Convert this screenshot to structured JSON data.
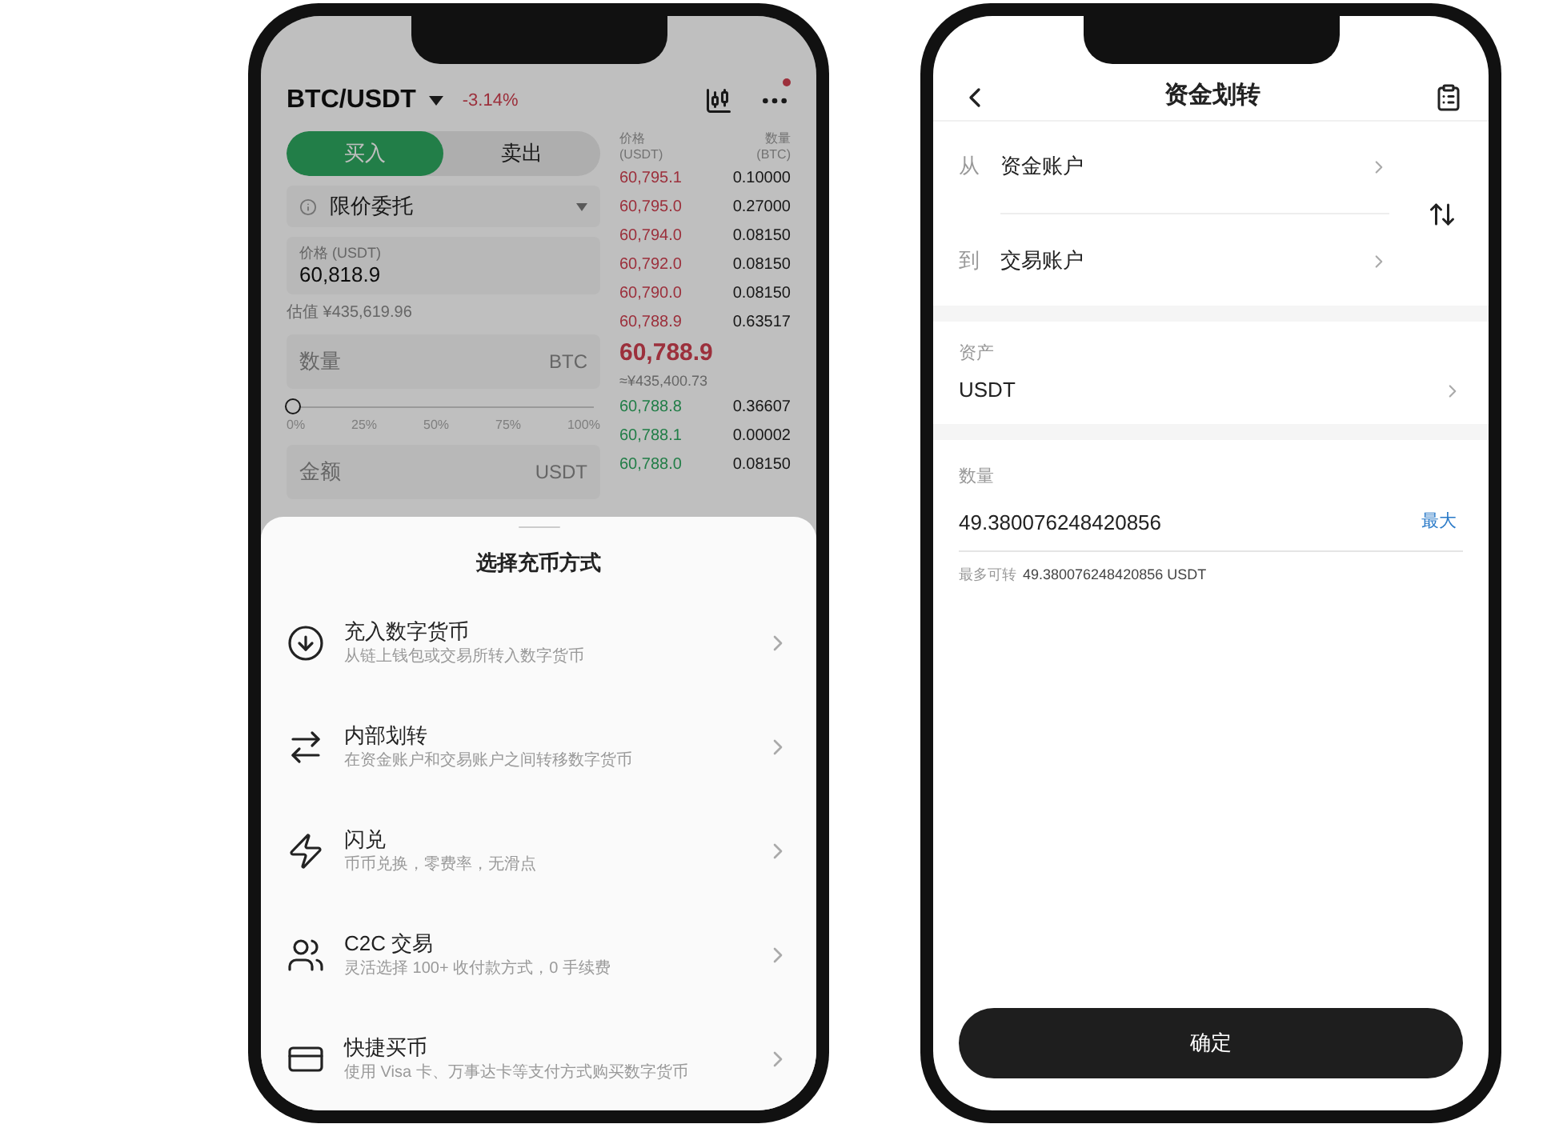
{
  "trade_screen": {
    "pair": "BTC/USDT",
    "change": "-3.14%",
    "side_tabs": [
      {
        "label": "买入",
        "selected": true
      },
      {
        "label": "卖出",
        "selected": false
      }
    ],
    "order_type": "限价委托",
    "price_field": {
      "label": "价格 (USDT)",
      "value": "60,818.9"
    },
    "estimate": "估值 ¥435,619.96",
    "quantity_field": {
      "placeholder": "数量",
      "unit": "BTC"
    },
    "slider": {
      "level": 0,
      "ticks": [
        "0%",
        "25%",
        "50%",
        "75%",
        "100%"
      ]
    },
    "amount_field": {
      "placeholder": "金额",
      "unit": "USDT"
    },
    "order_book": {
      "columns": [
        {
          "label": "价格",
          "unit": "(USDT)"
        },
        {
          "label": "数量",
          "unit": "(BTC)"
        }
      ],
      "asks": [
        {
          "price": "60,795.1",
          "qty": "0.10000"
        },
        {
          "price": "60,795.0",
          "qty": "0.27000"
        },
        {
          "price": "60,794.0",
          "qty": "0.08150"
        },
        {
          "price": "60,792.0",
          "qty": "0.08150"
        },
        {
          "price": "60,790.0",
          "qty": "0.08150"
        },
        {
          "price": "60,788.9",
          "qty": "0.63517"
        }
      ],
      "last_price": "60,788.9",
      "last_price_cny": "≈¥435,400.73",
      "bids": [
        {
          "price": "60,788.8",
          "qty": "0.36607"
        },
        {
          "price": "60,788.1",
          "qty": "0.00002"
        },
        {
          "price": "60,788.0",
          "qty": "0.08150"
        }
      ]
    }
  },
  "deposit_sheet": {
    "title": "选择充币方式",
    "options": [
      {
        "kind": "deposit",
        "title": "充入数字货币",
        "subtitle": "从链上钱包或交易所转入数字货币"
      },
      {
        "kind": "transfer",
        "title": "内部划转",
        "subtitle": "在资金账户和交易账户之间转移数字货币"
      },
      {
        "kind": "flash",
        "title": "闪兑",
        "subtitle": "币币兑换，零费率，无滑点"
      },
      {
        "kind": "c2c",
        "title": "C2C 交易",
        "subtitle": "灵活选择 100+ 收付款方式，0 手续费"
      },
      {
        "kind": "quick_buy",
        "title": "快捷买币",
        "subtitle": "使用 Visa 卡、万事达卡等支付方式购买数字货币"
      }
    ]
  },
  "transfer_screen": {
    "title": "资金划转",
    "from": {
      "label": "从",
      "account": "资金账户"
    },
    "to": {
      "label": "到",
      "account": "交易账户"
    },
    "asset": {
      "label": "资产",
      "value": "USDT"
    },
    "amount": {
      "label": "数量",
      "value": "49.380076248420856",
      "max": "最大"
    },
    "available_label": "最多可转",
    "available_value": "49.380076248420856 USDT",
    "confirm": "确定"
  }
}
